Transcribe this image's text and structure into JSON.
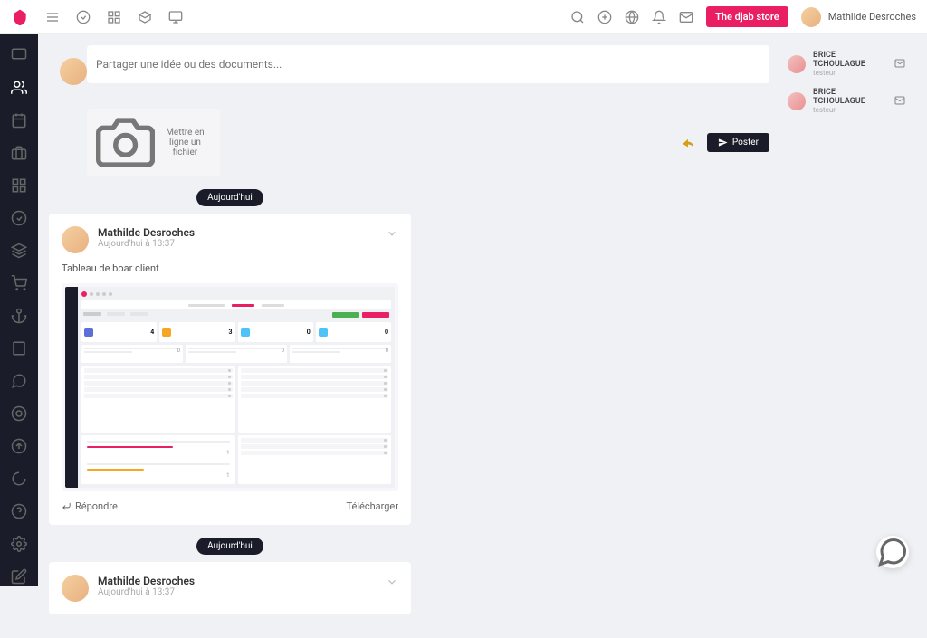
{
  "topbar": {
    "store_label": "The djab store",
    "user_name": "Mathilde Desroches"
  },
  "compose": {
    "placeholder": "Partager une idée ou des documents...",
    "upload_label": "Mettre en ligne un fichier",
    "post_label": "Poster"
  },
  "feed": {
    "day_label": "Aujourd'hui",
    "posts": [
      {
        "author": "Mathilde Desroches",
        "time": "Aujourd'hui à 13:37",
        "text": "Tableau de boar client",
        "reply_label": "Répondre",
        "download_label": "Télécharger"
      },
      {
        "author": "Mathilde Desroches",
        "time": "Aujourd'hui à 13:37"
      }
    ]
  },
  "contacts": [
    {
      "name": "BRICE TCHOULAGUE",
      "role": "testeur"
    },
    {
      "name": "BRICE TCHOULAGUE",
      "role": "testeur"
    }
  ],
  "mini_dashboard": {
    "stats": [
      {
        "value": "4",
        "color": "#5b6fd6"
      },
      {
        "value": "3",
        "color": "#f5a623"
      },
      {
        "value": "0",
        "color": "#4fc3f7"
      },
      {
        "value": "0",
        "color": "#4fc3f7"
      }
    ],
    "progress_values": [
      "1",
      "1"
    ]
  }
}
